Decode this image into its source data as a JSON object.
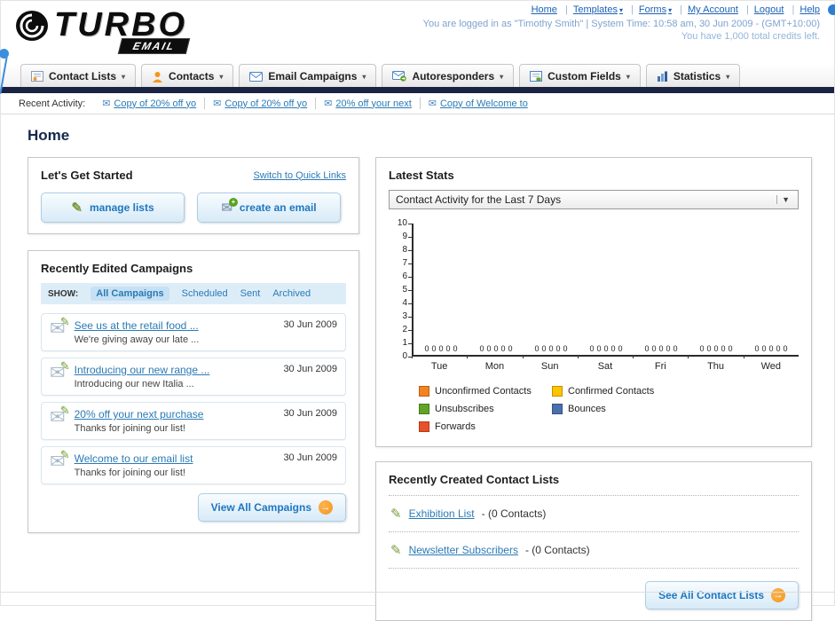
{
  "header": {
    "logo": {
      "word": "TURBO",
      "sub": "EMAIL"
    },
    "links": [
      {
        "label": "Home"
      },
      {
        "label": "Templates"
      },
      {
        "label": "Forms"
      },
      {
        "label": "My Account"
      },
      {
        "label": "Logout"
      },
      {
        "label": "Help"
      }
    ],
    "login_info": "You are logged in as \"Timothy Smith\" | System Time: 10:58 am, 30 Jun 2009 - (GMT+10:00)",
    "credits": "You have 1,000 total credits left."
  },
  "nav_tabs": [
    {
      "label": "Contact Lists"
    },
    {
      "label": "Contacts"
    },
    {
      "label": "Email Campaigns"
    },
    {
      "label": "Autoresponders"
    },
    {
      "label": "Custom Fields"
    },
    {
      "label": "Statistics"
    }
  ],
  "recent_activity": {
    "label": "Recent Activity:",
    "items": [
      {
        "label": "Copy of 20% off yo"
      },
      {
        "label": "Copy of 20% off yo"
      },
      {
        "label": "20% off your next"
      },
      {
        "label": "Copy of Welcome to"
      }
    ]
  },
  "page": {
    "title": "Home"
  },
  "get_started": {
    "title": "Let's Get Started",
    "switch_link": "Switch to Quick Links",
    "manage_lists": "manage lists",
    "create_email": "create an email"
  },
  "campaigns": {
    "title": "Recently Edited Campaigns",
    "show_label": "SHOW:",
    "filters": [
      {
        "label": "All Campaigns",
        "selected": true
      },
      {
        "label": "Scheduled",
        "selected": false
      },
      {
        "label": "Sent",
        "selected": false
      },
      {
        "label": "Archived",
        "selected": false
      }
    ],
    "items": [
      {
        "title": "See us at the retail food ...",
        "subtitle": "We're giving away our late ...",
        "date": "30 Jun 2009"
      },
      {
        "title": "Introducing our new range ...",
        "subtitle": "Introducing our new Italia ...",
        "date": "30 Jun 2009"
      },
      {
        "title": "20% off your next purchase",
        "subtitle": "Thanks for joining our list!",
        "date": "30 Jun 2009"
      },
      {
        "title": "Welcome to our email list",
        "subtitle": "Thanks for joining our list!",
        "date": "30 Jun 2009"
      }
    ],
    "view_all_label": "View All Campaigns"
  },
  "stats": {
    "title": "Latest Stats",
    "dropdown_value": "Contact Activity for the Last 7 Days",
    "chart_data": {
      "type": "bar",
      "title": "Contact Activity for the Last 7 Days",
      "categories": [
        "Tue",
        "Mon",
        "Sun",
        "Sat",
        "Fri",
        "Thu",
        "Wed"
      ],
      "series": [
        {
          "name": "Unconfirmed Contacts",
          "color": "#f5821f",
          "values": [
            0,
            0,
            0,
            0,
            0,
            0,
            0
          ]
        },
        {
          "name": "Confirmed Contacts",
          "color": "#fdc400",
          "values": [
            0,
            0,
            0,
            0,
            0,
            0,
            0
          ]
        },
        {
          "name": "Unsubscribes",
          "color": "#61a427",
          "values": [
            0,
            0,
            0,
            0,
            0,
            0,
            0
          ]
        },
        {
          "name": "Bounces",
          "color": "#4a6fad",
          "values": [
            0,
            0,
            0,
            0,
            0,
            0,
            0
          ]
        },
        {
          "name": "Forwards",
          "color": "#e8502a",
          "values": [
            0,
            0,
            0,
            0,
            0,
            0,
            0
          ]
        }
      ],
      "ylim": [
        0,
        10
      ],
      "ytick_step": 1,
      "grid": false,
      "legend_position": "bottom",
      "value_labels_shown": true
    }
  },
  "contact_lists": {
    "title": "Recently Created Contact Lists",
    "items": [
      {
        "name": "Exhibition List",
        "detail": " - (0 Contacts)"
      },
      {
        "name": "Newsletter Subscribers",
        "detail": " - (0 Contacts)"
      }
    ],
    "see_all_label": "See All Contact Lists"
  }
}
